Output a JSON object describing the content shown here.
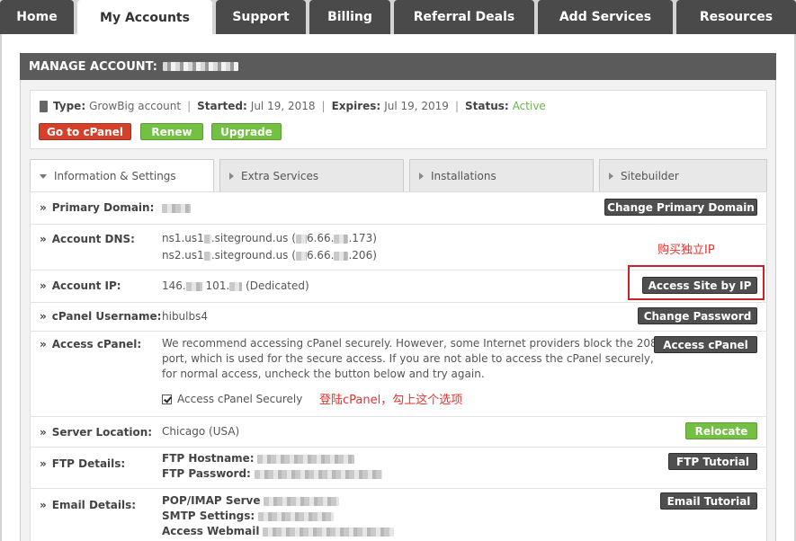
{
  "nav": {
    "tabs": [
      {
        "label": "Home"
      },
      {
        "label": "My Accounts"
      },
      {
        "label": "Support"
      },
      {
        "label": "Billing"
      },
      {
        "label": "Referral Deals"
      },
      {
        "label": "Add Services"
      },
      {
        "label": "Resources"
      }
    ],
    "active_index": 1
  },
  "manage": {
    "title": "MANAGE ACCOUNT:"
  },
  "summary": {
    "type_label": "Type:",
    "type_value": "GrowBig account",
    "started_label": "Started:",
    "started_value": "Jul 19, 2018",
    "expires_label": "Expires:",
    "expires_value": "Jul 19, 2019",
    "status_label": "Status:",
    "status_value": "Active",
    "separator": "|",
    "buttons": {
      "cpanel": "Go to cPanel",
      "renew": "Renew",
      "upgrade": "Upgrade"
    }
  },
  "tabs": [
    {
      "label": "Information & Settings"
    },
    {
      "label": "Extra Services"
    },
    {
      "label": "Installations"
    },
    {
      "label": "Sitebuilder"
    }
  ],
  "rows": {
    "arrow": "»",
    "primary_domain": {
      "label": "Primary Domain:",
      "button": "Change Primary Domain"
    },
    "dns": {
      "label": "Account DNS:",
      "ns1_a": "ns1.us1",
      "ns1_b": ".siteground.us (",
      "ns1_c": "6.66.",
      "ns1_d": ".173)",
      "ns2_a": "ns2.us1",
      "ns2_b": ".siteground.us (",
      "ns2_c": "6.66.",
      "ns2_d": ".206)"
    },
    "ip": {
      "label": "Account IP:",
      "ip_a": "146.",
      "ip_b": "101.",
      "ip_c": "(Dedicated)",
      "button": "Access Site by IP"
    },
    "cpanel_user": {
      "label": "cPanel Username:",
      "value": "hibulbs4",
      "button": "Change Password"
    },
    "access_cpanel": {
      "label": "Access cPanel:",
      "line1": "We recommend accessing cPanel securely. However, some Internet providers block the 2083",
      "line2": "port, which is used for the secure access. If you are not able to access the cPanel securely,",
      "line3": "for normal access, uncheck the button below and try again.",
      "checkbox_label": "Access cPanel Securely",
      "button": "Access cPanel"
    },
    "server": {
      "label": "Server Location:",
      "value": "Chicago (USA)",
      "button": "Relocate"
    },
    "ftp": {
      "label": "FTP Details:",
      "hostname_label": "FTP Hostname:",
      "password_label": "FTP Password:",
      "button": "FTP Tutorial"
    },
    "email": {
      "label": "Email Details:",
      "pop_label": "POP/IMAP Serve",
      "smtp_label": "SMTP Settings:",
      "webmail_label": "Access Webmail",
      "button": "Email Tutorial"
    }
  },
  "annotations": {
    "buy_ip": "购买独立IP",
    "login_cpanel": "登陆cPanel，勾上这个选项"
  },
  "colors": {
    "nav_bg": "#4a4a4a",
    "header_bar": "#5b5b5b",
    "red_button": "#d5402a",
    "green_button": "#74c043",
    "dark_button": "#4f4f4f",
    "status_active": "#6ab04c",
    "annotation_red": "#e8312a"
  }
}
